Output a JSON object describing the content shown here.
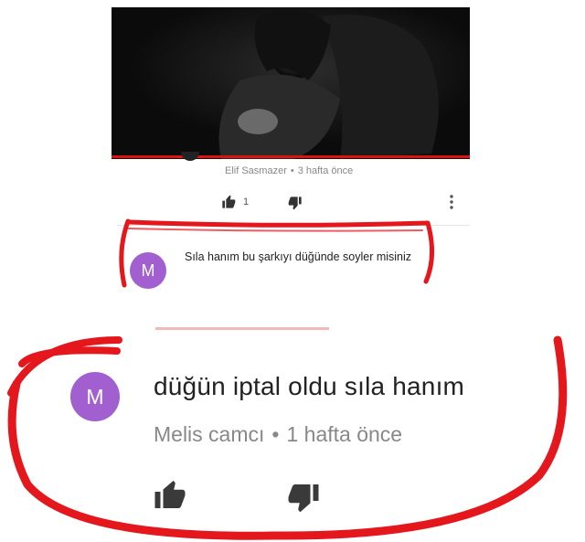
{
  "video": {
    "author": "Elif Sasmazer",
    "time": "3 hafta önce",
    "likes": "1",
    "progress_color": "#d11111"
  },
  "first_comment": {
    "avatar_letter": "M",
    "text": "Sıla hanım bu şarkıyı düğünde soyler misiniz"
  },
  "second_comment": {
    "avatar_letter": "M",
    "text": "düğün iptal oldu sıla hanım",
    "author": "Melis camcı",
    "time": "1 hafta önce"
  },
  "colors": {
    "avatar": "#a25fcf",
    "scribble": "#e4171c"
  },
  "icons": [
    "thumb-up-icon",
    "thumb-down-icon",
    "more-vertical-icon"
  ]
}
